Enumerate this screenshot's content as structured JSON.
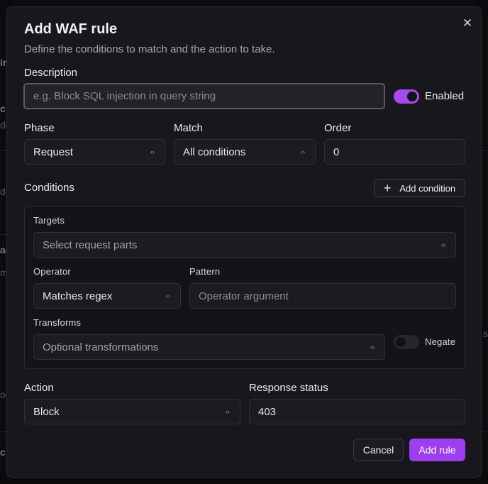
{
  "dialog": {
    "title": "Add WAF rule",
    "subtitle": "Define the conditions to match and the action to take."
  },
  "background_fragments": [
    "ir",
    "c",
    "do",
    "d",
    "ac",
    "mi",
    "oo",
    "c",
    "s"
  ],
  "description": {
    "label": "Description",
    "placeholder": "e.g. Block SQL injection in query string"
  },
  "enabled": {
    "label": "Enabled",
    "on": true
  },
  "phase": {
    "label": "Phase",
    "value": "Request"
  },
  "match": {
    "label": "Match",
    "value": "All conditions"
  },
  "order": {
    "label": "Order",
    "value": "0"
  },
  "conditions": {
    "label": "Conditions",
    "add_button": "Add condition",
    "targets": {
      "label": "Targets",
      "placeholder": "Select request parts"
    },
    "operator": {
      "label": "Operator",
      "value": "Matches regex"
    },
    "pattern": {
      "label": "Pattern",
      "placeholder": "Operator argument"
    },
    "transforms": {
      "label": "Transforms",
      "placeholder": "Optional transformations"
    },
    "negate": {
      "label": "Negate",
      "on": false
    }
  },
  "action": {
    "label": "Action",
    "value": "Block"
  },
  "response_status": {
    "label": "Response status",
    "value": "403"
  },
  "footer": {
    "cancel": "Cancel",
    "submit": "Add rule"
  },
  "colors": {
    "accent": "#a24bf0",
    "accent_button": "#9d3ff0",
    "dialog_bg": "#17171c"
  }
}
